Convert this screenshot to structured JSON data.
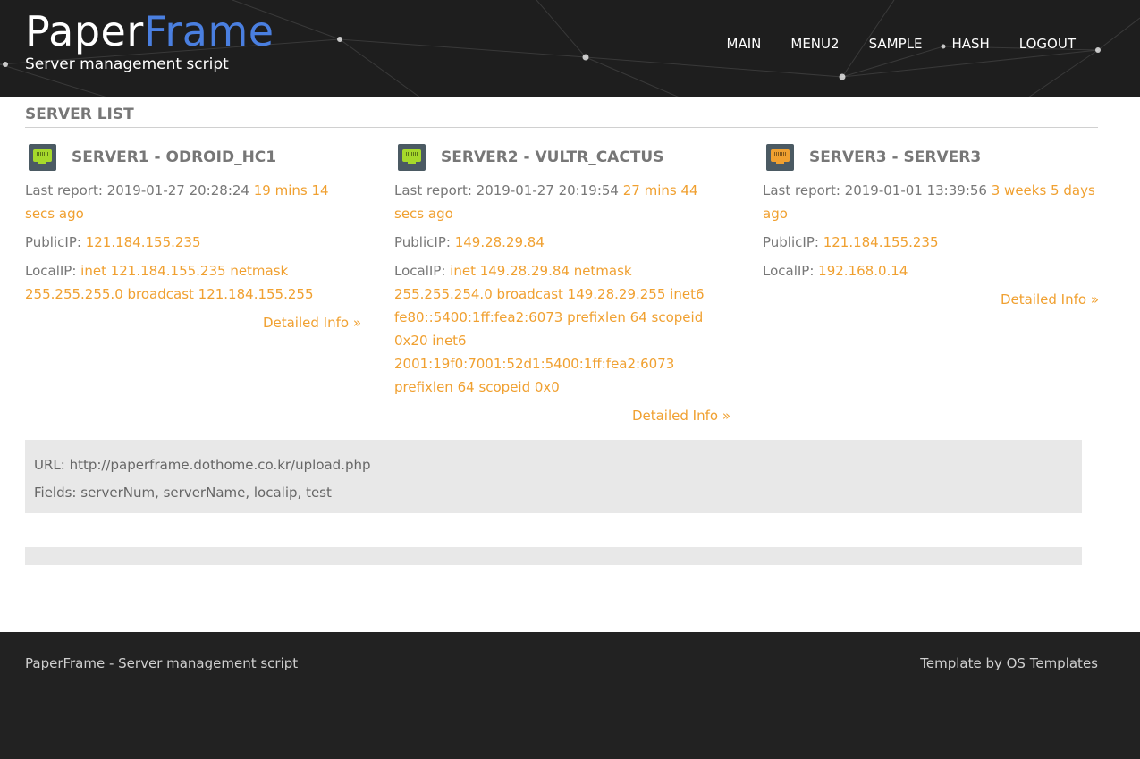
{
  "header": {
    "logo_part1": "Paper",
    "logo_part2": "Frame",
    "tagline": "Server management script",
    "accent_color": "#4a7fe0"
  },
  "nav": {
    "items": [
      {
        "label": "MAIN"
      },
      {
        "label": "MENU2"
      },
      {
        "label": "SAMPLE"
      },
      {
        "label": "HASH"
      },
      {
        "label": "LOGOUT"
      }
    ]
  },
  "main": {
    "section_title": "SERVER LIST",
    "servers": [
      {
        "name": "SERVER1 - ODROID_HC1",
        "icon": "ethernet-port-icon",
        "status_color": "#a6d92b",
        "last_report_label": "Last report: ",
        "last_report": "2019-01-27 20:28:24 ",
        "ago": "19 mins 14 secs ago",
        "public_ip_label": "PublicIP: ",
        "public_ip": "121.184.155.235",
        "local_ip_label": "LocalIP: ",
        "local_ip": "inet 121.184.155.235 netmask 255.255.255.0 broadcast 121.184.155.255",
        "more_label": "Detailed Info »"
      },
      {
        "name": "SERVER2 - VULTR_CACTUS",
        "icon": "ethernet-port-icon",
        "status_color": "#a6d92b",
        "last_report_label": "Last report: ",
        "last_report": "2019-01-27 20:19:54 ",
        "ago": "27 mins 44 secs ago",
        "public_ip_label": "PublicIP: ",
        "public_ip": "149.28.29.84",
        "local_ip_label": "LocalIP: ",
        "local_ip": "inet 149.28.29.84 netmask 255.255.254.0 broadcast 149.28.29.255 inet6 fe80::5400:1ff:fea2:6073 prefixlen 64 scopeid 0x20 inet6 2001:19f0:7001:52d1:5400:1ff:fea2:6073 prefixlen 64 scopeid 0x0",
        "more_label": "Detailed Info »"
      },
      {
        "name": "SERVER3 - SERVER3",
        "icon": "ethernet-port-icon",
        "status_color": "#f0a030",
        "last_report_label": "Last report: ",
        "last_report": "2019-01-01 13:39:56 ",
        "ago": "3 weeks 5 days ago",
        "public_ip_label": "PublicIP: ",
        "public_ip": "121.184.155.235",
        "local_ip_label": "LocalIP: ",
        "local_ip": "192.168.0.14",
        "more_label": "Detailed Info »"
      }
    ],
    "info": {
      "url_line": "URL: http://paperframe.dothome.co.kr/upload.php",
      "fields_line": "Fields: serverNum, serverName, localip, test"
    }
  },
  "footer": {
    "left": "PaperFrame - Server management script",
    "right": "Template by OS Templates"
  },
  "colors": {
    "highlight": "#f0a030",
    "header_bg": "#1e1e1e",
    "footer_bg": "#222222"
  }
}
